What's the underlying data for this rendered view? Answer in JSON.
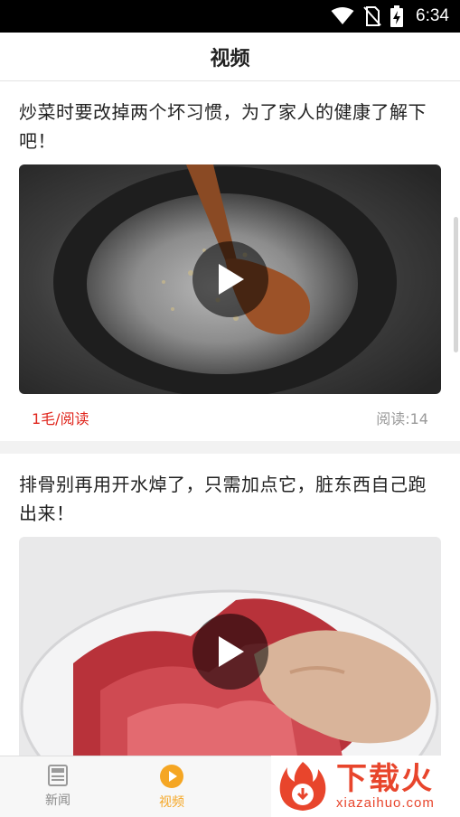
{
  "status_bar": {
    "time": "6:34",
    "icons": [
      "wifi-icon",
      "no-sim-icon",
      "battery-charging-icon"
    ]
  },
  "app_bar": {
    "title": "视频"
  },
  "feed": [
    {
      "title": "炒菜时要改掉两个坏习惯，为了家人的健康了解下吧！",
      "reward": "1毛/阅读",
      "reads": "阅读:14",
      "thumbnail": "pan-with-wooden-spatula"
    },
    {
      "title": "排骨别再用开水焯了，只需加点它，脏东西自己跑出来！",
      "thumbnail": "ribs-in-glass-bowl"
    }
  ],
  "tab_bar": {
    "tabs": [
      {
        "label": "新闻",
        "icon": "newspaper-icon",
        "active": false
      },
      {
        "label": "视频",
        "icon": "play-circle-icon",
        "active": true
      }
    ]
  },
  "watermark": {
    "cn": "下载火",
    "en": "xiazaihuo.com"
  },
  "colors": {
    "accent": "#f5a623",
    "reward": "#e0261d",
    "muted": "#9a9a9a"
  }
}
